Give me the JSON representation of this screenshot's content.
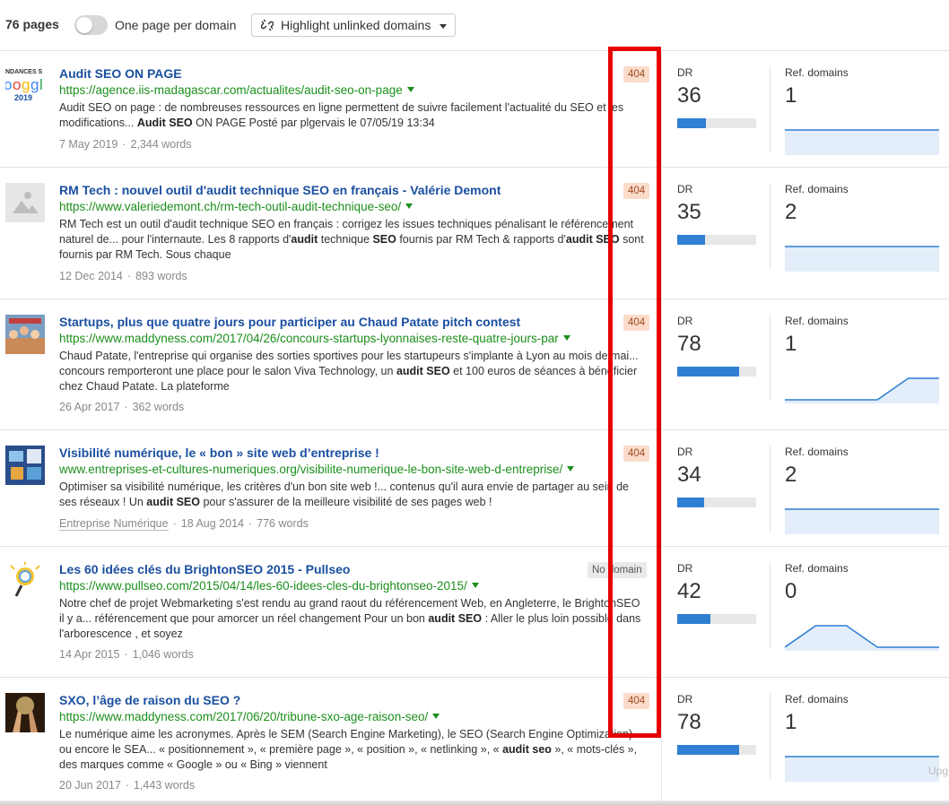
{
  "toolbar": {
    "pages_count": "76 pages",
    "toggle_label": "One page per domain",
    "toggle_on": false,
    "highlight_label": "Highlight unlinked domains"
  },
  "labels": {
    "dr": "DR",
    "ref_domains": "Ref. domains"
  },
  "results": [
    {
      "title": "Audit SEO ON PAGE",
      "url": "https://agence.iis-madagascar.com/actualites/audit-seo-on-page",
      "snippet_html": "Audit SEO on page : de nombreuses ressources en ligne permettent de suivre facilement l'actualité du SEO et les modifications... <b>Audit SEO</b> ON PAGE Posté par plgervais le 07&#x2F;05&#x2F;19 13:34",
      "category": "",
      "date": "7 May 2019",
      "words": "2,344 words",
      "status": "404",
      "dr": "36",
      "ref_domains": "1",
      "thumb": "google-2019-logo"
    },
    {
      "title": "RM Tech : nouvel outil d'audit technique SEO en français - Valérie Demont",
      "url": "https://www.valeriedemont.ch/rm-tech-outil-audit-technique-seo/",
      "snippet_html": "RM Tech est un outil d'audit technique SEO en français : corrigez les issues techniques pénalisant le référencement naturel de... pour l'internaute. Les 8 rapports d'<b>audit</b> technique <b>SEO</b> fournis par RM Tech &amp; rapports d'<b>audit SEO</b> sont fournis par RM Tech. Sous chaque",
      "category": "",
      "date": "12 Dec 2014",
      "words": "893 words",
      "status": "404",
      "dr": "35",
      "ref_domains": "2",
      "thumb": "image-placeholder-icon"
    },
    {
      "title": "Startups, plus que quatre jours pour participer au Chaud Patate pitch contest",
      "url": "https://www.maddyness.com/2017/04/26/concours-startups-lyonnaises-reste-quatre-jours-par",
      "snippet_html": "Chaud Patate, l'entreprise qui organise des sorties sportives pour les startupeurs s'implante à Lyon au mois de mai... concours remporteront une place pour le salon Viva Technology, un <b>audit SEO</b> et 100 euros de séances à bénéficier chez Chaud Patate. La plateforme",
      "category": "",
      "date": "26 Apr 2017",
      "words": "362 words",
      "status": "404",
      "dr": "78",
      "ref_domains": "1",
      "thumb": "team-photo"
    },
    {
      "title": "Visibilité numérique, le « bon » site web d’entreprise !",
      "url": "www.entreprises-et-cultures-numeriques.org/visibilite-numerique-le-bon-site-web-d-entreprise/",
      "snippet_html": "Optimiser sa visibilité numérique, les critères d'un bon site web !... contenus qu'il aura envie de partager au sein de ses réseaux ! Un <b>audit SEO</b> pour s'assurer de la meilleure visibilité de ses pages web !",
      "category": "Entreprise Numérique",
      "date": "18 Aug 2014",
      "words": "776 words",
      "status": "404",
      "dr": "34",
      "ref_domains": "2",
      "thumb": "digital-collage"
    },
    {
      "title": "Les 60 idées clés du BrightonSEO 2015 - Pullseo",
      "url": "https://www.pullseo.com/2015/04/14/les-60-idees-cles-du-brightonseo-2015/",
      "snippet_html": "Notre chef de projet Webmarketing s'est rendu au grand raout du référencement Web, en Angleterre, le BrightonSEO il y a... référencement que pour amorcer un réel changement Pour un bon <b>audit SEO</b> : Aller le plus loin possible dans l'arborescence , et soyez",
      "category": "",
      "date": "14 Apr 2015",
      "words": "1,046 words",
      "status": "No domain",
      "dr": "42",
      "ref_domains": "0",
      "thumb": "seo-lightbulb"
    },
    {
      "title": "SXO, l’âge de raison du SEO ?",
      "url": "https://www.maddyness.com/2017/06/20/tribune-sxo-age-raison-seo/",
      "snippet_html": "Le numérique aime les acronymes. Après le SEM (Search Engine Marketing), le SEO (Search Engine Optimization) ou encore le SEA... « positionnement », « première page », « position », « netlinking », « <b>audit seo</b> », « mots-clés », des marques comme « Google » ou « Bing » viennent",
      "category": "",
      "date": "20 Jun 2017",
      "words": "1,443 words",
      "status": "404",
      "dr": "78",
      "ref_domains": "1",
      "thumb": "hands-photo"
    }
  ],
  "dr_fill_percent": [
    36,
    35,
    78,
    34,
    42,
    78
  ],
  "ref_domain_trends": [
    [
      1,
      1,
      1,
      1,
      1,
      1
    ],
    [
      2,
      2,
      2,
      2,
      2,
      2
    ],
    [
      0,
      0,
      0,
      0,
      1,
      1
    ],
    [
      2,
      2,
      2,
      2,
      2,
      2
    ],
    [
      0,
      1,
      1,
      0,
      0,
      0
    ],
    [
      1,
      1,
      1,
      1,
      1,
      1
    ]
  ],
  "upgrade_hint": "Upg",
  "colors": {
    "title": "#1a4fa0",
    "url": "#1c8f1c",
    "bar": "#2f7fd2",
    "highlight": "#e60000",
    "badge_404": "#fbdccb"
  }
}
